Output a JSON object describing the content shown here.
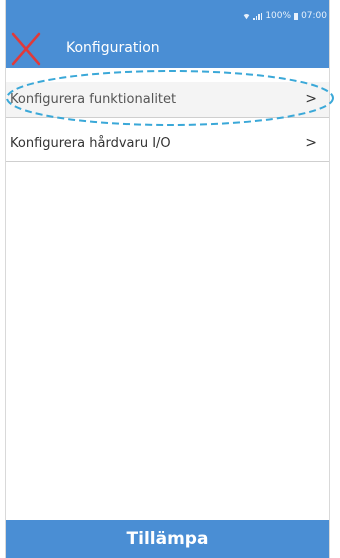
{
  "status_bar": {
    "battery": "100%",
    "time": "07:00"
  },
  "app_bar": {
    "title": "Konfiguration",
    "back_icon": "red-x-close-icon"
  },
  "menu": {
    "items": [
      {
        "label": "Konfigurera funktionalitet",
        "chevron": ">",
        "highlighted": true
      },
      {
        "label": "Konfigurera hårdvaru I/O",
        "chevron": ">"
      }
    ]
  },
  "footer": {
    "apply_label": "Tillämpa"
  },
  "colors": {
    "primary": "#4a8ed4",
    "close_icon": "#e03a3a",
    "highlight_ring": "#3aa8d8"
  }
}
